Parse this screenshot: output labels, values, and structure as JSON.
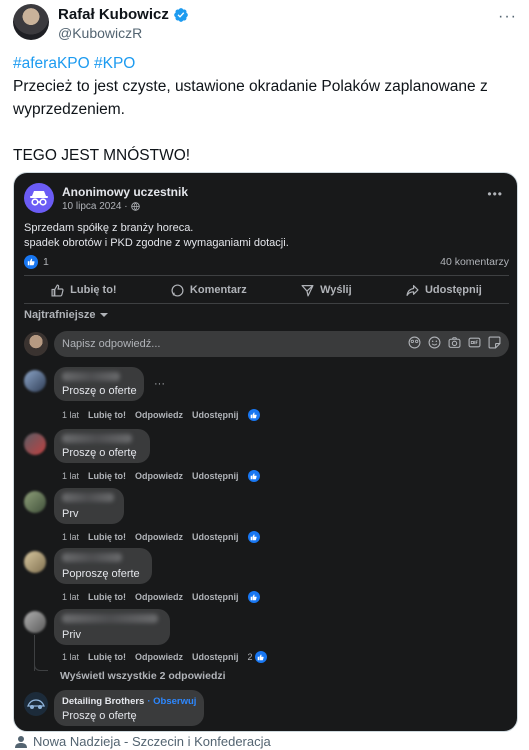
{
  "tweet": {
    "author_name": "Rafał Kubowicz",
    "handle": "@KubowiczR",
    "hashtags": [
      "#aferaKPO",
      "#KPO"
    ],
    "body_line1": "Przecież to jest czyste, ustawione okradanie Polaków zaplanowane z wyprzedzeniem.",
    "body_line2": "TEGO JEST MNÓSTWO!",
    "more_label": "···",
    "colors": {
      "link": "#1d9bf0",
      "verified": "#1d9bf0"
    }
  },
  "screenshot": {
    "post": {
      "author": "Anonimowy uczestnik",
      "date": "10 lipca 2024 ·",
      "more_label": "•••",
      "body_line1": "Sprzedam spółkę z branży horeca.",
      "body_line2": "spadek obrotów i PKD zgodne z wymaganiami dotacji.",
      "like_count": "1",
      "comment_count": "40 komentarzy"
    },
    "actions": [
      {
        "label": "Lubię to!",
        "icon": "thumbs-up-icon"
      },
      {
        "label": "Komentarz",
        "icon": "comment-icon"
      },
      {
        "label": "Wyślij",
        "icon": "send-icon"
      },
      {
        "label": "Udostępnij",
        "icon": "share-icon"
      }
    ],
    "sort_label": "Najtrafniejsze",
    "reply_placeholder": "Napisz odpowiedź...",
    "comment_meta": {
      "time": "1 lat",
      "like": "Lubię to!",
      "reply": "Odpowiedz",
      "share": "Udostępnij"
    },
    "comments": [
      {
        "text": "Proszę o oferte",
        "reactions": ""
      },
      {
        "text": "Proszę o ofertę",
        "reactions": ""
      },
      {
        "text": "Prv",
        "reactions": ""
      },
      {
        "text": "Poproszę oferte",
        "reactions": ""
      },
      {
        "text": "Priv",
        "reactions": "2"
      }
    ],
    "view_replies": "Wyświetl wszystkie 2 odpowiedzi",
    "last_comment": {
      "author": "Detailing Brothers",
      "follow": "· Obserwuj",
      "text": "Proszę o ofertę"
    },
    "colors": {
      "background": "#18191a",
      "bubble": "#3a3b3c",
      "accent": "#1877f2"
    }
  },
  "footer": {
    "text": "Nowa Nadzieja - Szczecin i Konfederacja"
  }
}
